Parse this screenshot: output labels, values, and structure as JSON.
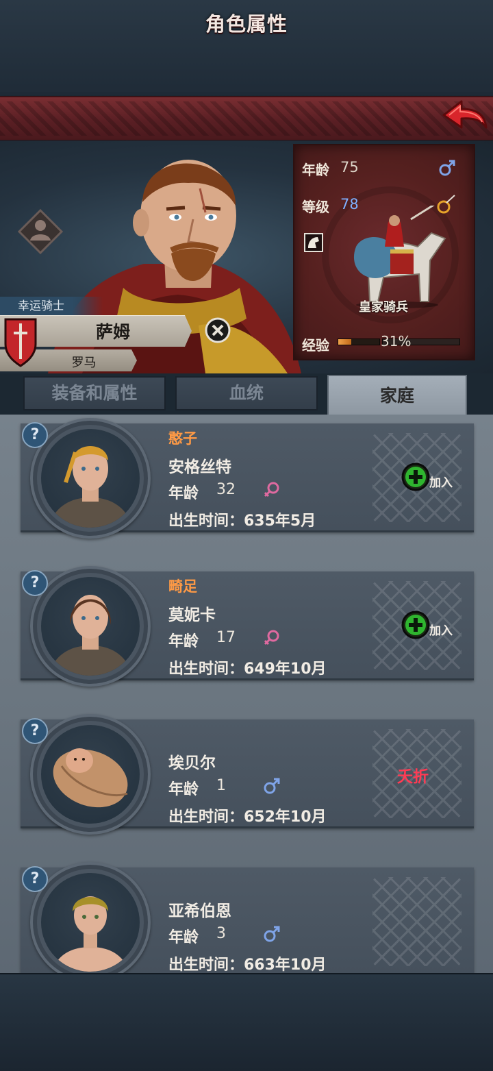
{
  "header": {
    "title": "角色属性",
    "back_icon": "red-back-arrow-icon"
  },
  "hero": {
    "rank": "幸运骑士",
    "name": "萨姆",
    "origin": "罗马",
    "stats": {
      "age_label": "年龄",
      "age": "75",
      "gender": "male",
      "level_label": "等级",
      "level": "78",
      "unit": "皇家骑兵",
      "exp_label": "经验",
      "exp_percent": "31%",
      "exp_fraction": 0.31
    }
  },
  "tabs": [
    {
      "label": "装备和属性",
      "active": false
    },
    {
      "label": "血统",
      "active": false
    },
    {
      "label": "家庭",
      "active": true
    }
  ],
  "family": [
    {
      "trait": "憨子",
      "name": "安格丝特",
      "age_label": "年龄",
      "age": "32",
      "gender": "female",
      "birth": "出生时间：635年5月",
      "action": "加入"
    },
    {
      "trait": "畸足",
      "name": "莫妮卡",
      "age_label": "年龄",
      "age": "17",
      "gender": "female",
      "birth": "出生时间：649年10月",
      "action": "加入"
    },
    {
      "trait": "",
      "name": "埃贝尔",
      "age_label": "年龄",
      "age": "1",
      "gender": "male",
      "birth": "出生时间：652年10月",
      "status": "夭折"
    },
    {
      "trait": "",
      "name": "亚希伯恩",
      "age_label": "年龄",
      "age": "3",
      "gender": "male",
      "birth": "出生时间：663年10月"
    }
  ],
  "colors": {
    "title_bar": "#5a1f24",
    "trait": "#ff9a45",
    "male": "#7fa4e8",
    "female": "#e06aa0",
    "dead": "#ff3b54",
    "join": "#2fb52f"
  }
}
